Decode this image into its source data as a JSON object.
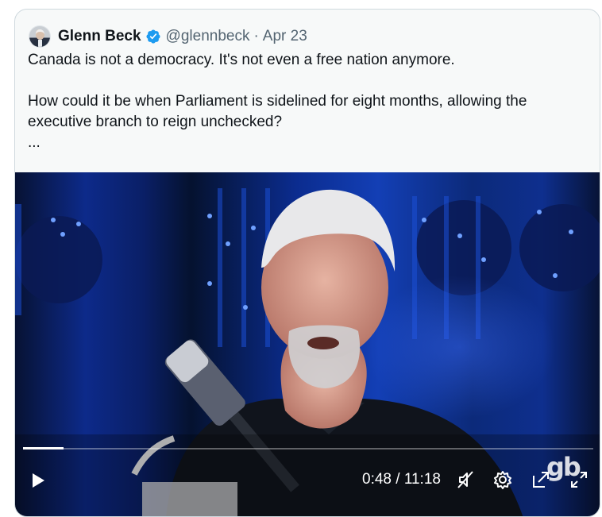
{
  "tweet": {
    "author_name": "Glenn Beck",
    "handle": "@glennbeck",
    "separator": "·",
    "date": "Apr 23",
    "text_line1": "Canada is not a democracy. It's not even a free nation anymore.",
    "text_line2": "How could it be when Parliament is sidelined for eight months, allowing the executive branch to reign unchecked?",
    "text_more": "...",
    "accent_color": "#1d9bf0"
  },
  "video": {
    "time_display": "0:48 / 11:18",
    "progress_fraction": 0.071,
    "watermark": "gb",
    "icons": [
      "play-icon",
      "muted-speaker-icon",
      "settings-gear-icon",
      "pop-out-icon",
      "fullscreen-icon"
    ]
  }
}
